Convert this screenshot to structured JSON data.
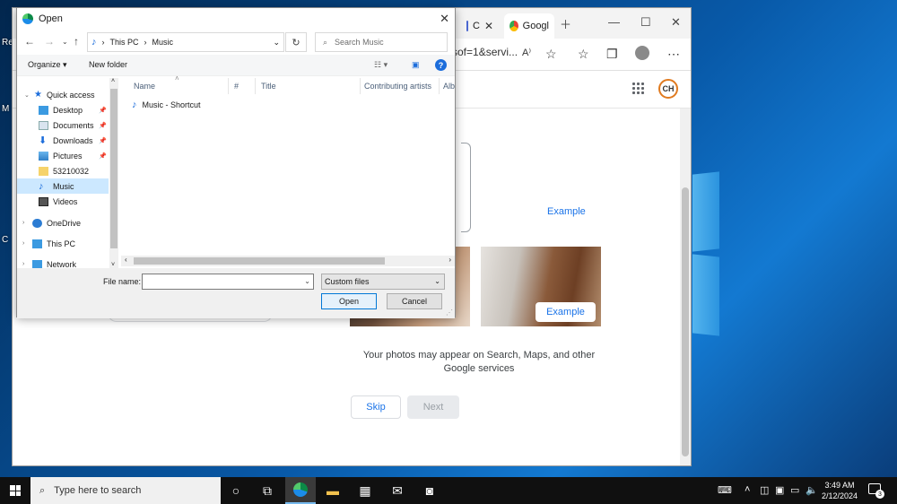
{
  "browser": {
    "tabs": [
      {
        "label": "C",
        "color": "#4a66d0"
      },
      {
        "label": "Googl",
        "color": "#e94235"
      }
    ],
    "url_fragment": "sof=1&servi...",
    "profile_initials": "CH",
    "page": {
      "example_label_top": "Example",
      "example_label_photo": "Example",
      "info_text": "Your photos may appear on Search, Maps, and other Google services",
      "skip_label": "Skip",
      "next_label": "Next"
    }
  },
  "dialog": {
    "title": "Open",
    "breadcrumb": [
      "This PC",
      "Music"
    ],
    "search_placeholder": "Search Music",
    "organize_label": "Organize",
    "new_folder_label": "New folder",
    "nav_items": [
      {
        "label": "Quick access",
        "icon": "star-icon",
        "pinned": false,
        "expandable": false
      },
      {
        "label": "Desktop",
        "icon": "desktop-folder-icon",
        "pinned": true
      },
      {
        "label": "Documents",
        "icon": "documents-folder-icon",
        "pinned": true
      },
      {
        "label": "Downloads",
        "icon": "downloads-folder-icon",
        "pinned": true
      },
      {
        "label": "Pictures",
        "icon": "pictures-folder-icon",
        "pinned": true
      },
      {
        "label": "53210032",
        "icon": "folder-icon",
        "pinned": false
      },
      {
        "label": "Music",
        "icon": "music-folder-icon",
        "pinned": false,
        "selected": true
      },
      {
        "label": "Videos",
        "icon": "videos-folder-icon",
        "pinned": false
      },
      {
        "label": "OneDrive",
        "icon": "onedrive-icon",
        "expandable": true
      },
      {
        "label": "This PC",
        "icon": "computer-icon",
        "expandable": true
      },
      {
        "label": "Network",
        "icon": "network-icon",
        "expandable": true
      }
    ],
    "columns": [
      "Name",
      "#",
      "Title",
      "Contributing artists",
      "Album"
    ],
    "files": [
      {
        "name": "Music - Shortcut",
        "icon": "music-shortcut-icon"
      }
    ],
    "file_name_label": "File name:",
    "file_name_value": "",
    "file_type": "Custom files",
    "open_label": "Open",
    "cancel_label": "Cancel"
  },
  "taskbar": {
    "search_placeholder": "Type here to search",
    "time": "3:49 AM",
    "date": "2/12/2024",
    "notification_count": "3"
  }
}
